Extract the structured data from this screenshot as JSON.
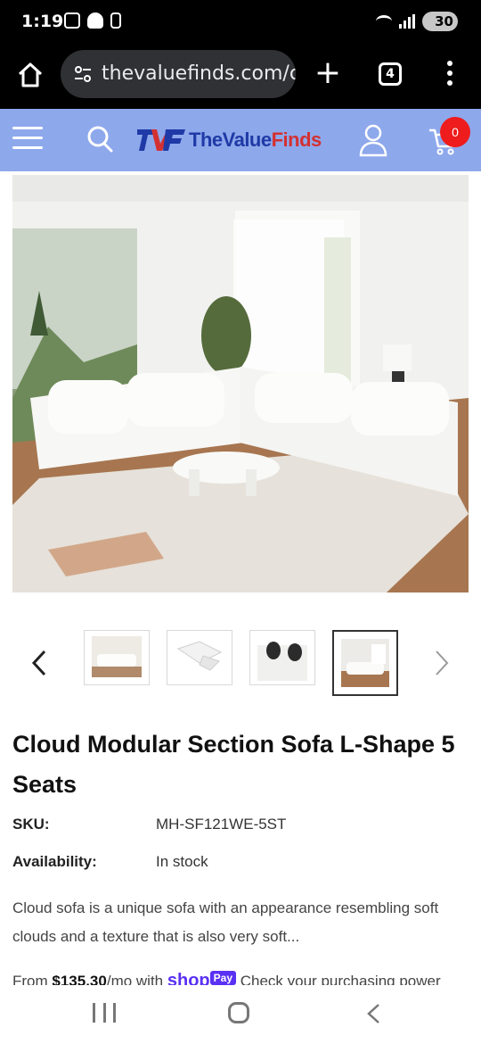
{
  "status_bar": {
    "time": "1:19",
    "battery": "30",
    "icons": [
      "screenshot-icon",
      "snapchat-icon",
      "phone-lock-icon",
      "wifi-icon",
      "signal-icon",
      "battery-icon"
    ]
  },
  "browser": {
    "url": "thevaluefinds.com/co",
    "tab_count": "4",
    "icons": [
      "home-icon",
      "site-settings-icon",
      "new-tab-icon",
      "tabs-icon",
      "menu-icon"
    ]
  },
  "site_header": {
    "logo_the": "The",
    "logo_value": "Value",
    "logo_finds": "Finds",
    "cart_count": "0",
    "colors": {
      "header_bg": "#8ea8ec",
      "logo_blue": "#1f3aa6",
      "logo_red": "#d33131",
      "badge": "#ee1c1c"
    }
  },
  "gallery": {
    "thumbnail_count": 4,
    "active_thumbnail": 4,
    "icons": [
      "chevron-left-icon",
      "chevron-right-icon"
    ]
  },
  "product": {
    "title": "Cloud Modular Section Sofa L-Shape 5 Seats",
    "sku_label": "SKU:",
    "sku_value": "MH-SF121WE-5ST",
    "availability_label": "Availability:",
    "availability_value": "In stock",
    "description": "Cloud sofa is a unique sofa with an appearance resembling soft clouds and a texture that is also very soft...",
    "payment_prefix": "From ",
    "payment_amount": "$135.30",
    "payment_mid": "/mo with ",
    "shoppay_shop": "shop",
    "shoppay_pay": "Pay",
    "payment_suffix": "  Check your purchasing power"
  },
  "nav_bar": {
    "icons": [
      "recents-icon",
      "home-circle-icon",
      "back-icon"
    ]
  }
}
